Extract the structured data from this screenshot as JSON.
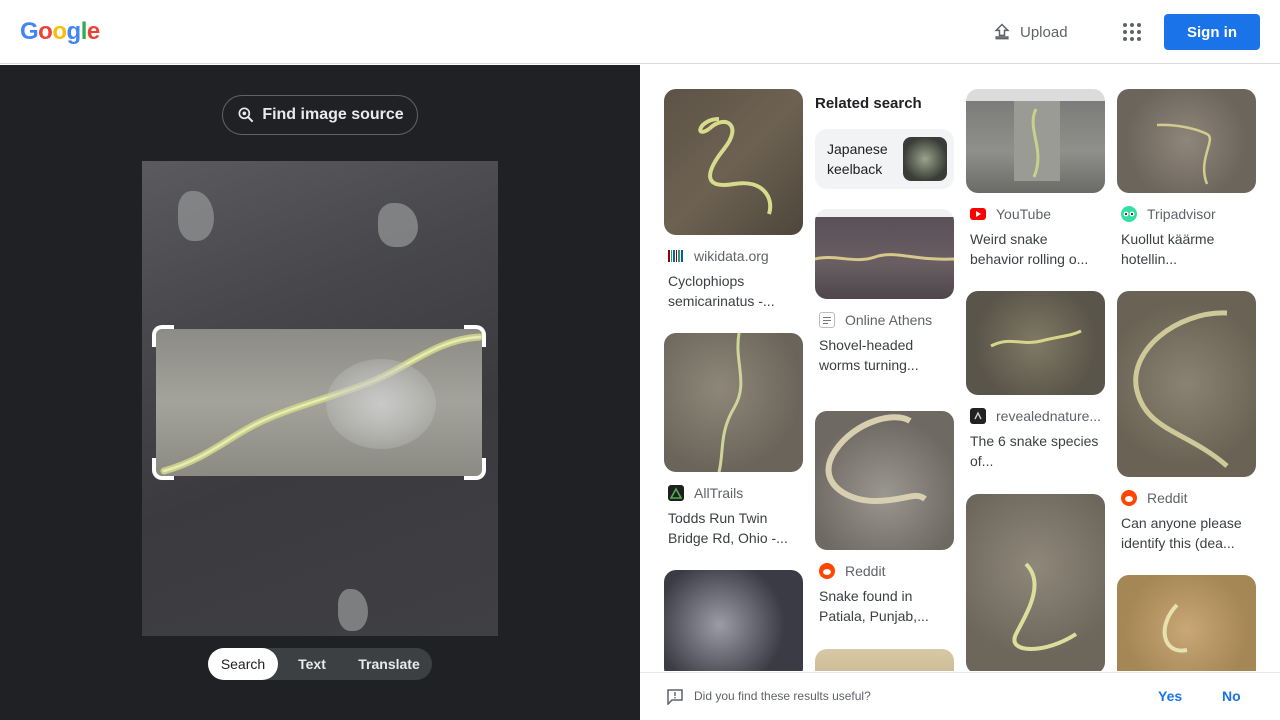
{
  "header": {
    "logo_letters": [
      "G",
      "o",
      "o",
      "g",
      "l",
      "e"
    ],
    "logo_colors": [
      "#4285f4",
      "#ea4335",
      "#fbbc05",
      "#4285f4",
      "#34a853",
      "#ea4335"
    ],
    "upload_label": "Upload",
    "apps_icon": "apps-grid-icon",
    "signin_label": "Sign in"
  },
  "left": {
    "find_source_label": "Find image source",
    "modes": [
      {
        "label": "Search",
        "active": true
      },
      {
        "label": "Text",
        "active": false
      },
      {
        "label": "Translate",
        "active": false
      }
    ]
  },
  "related": {
    "heading": "Related search",
    "chip_label": "Japanese keelback"
  },
  "results": [
    {
      "source": "wikidata.org",
      "title": "Cyclophiops semicarinatus -..."
    },
    {
      "source": "AllTrails",
      "title": "Todds Run Twin Bridge Rd, Ohio -..."
    },
    {
      "source": "Online Athens",
      "title": "Shovel-headed worms turning..."
    },
    {
      "source": "Reddit",
      "title": "Snake found in Patiala, Punjab,..."
    },
    {
      "source": "YouTube",
      "title": "Weird snake behavior rolling o..."
    },
    {
      "source": "revealednature...",
      "title": "The 6 snake species of..."
    },
    {
      "source": "Tripadvisor",
      "title": "Kuollut käärme hotellin..."
    },
    {
      "source": "Reddit",
      "title": "Can anyone please identify this (dea..."
    }
  ],
  "feedback": {
    "question": "Did you find these results useful?",
    "yes": "Yes",
    "no": "No"
  },
  "colors": {
    "accent": "#1a73e8",
    "dark_panel": "#202124"
  }
}
